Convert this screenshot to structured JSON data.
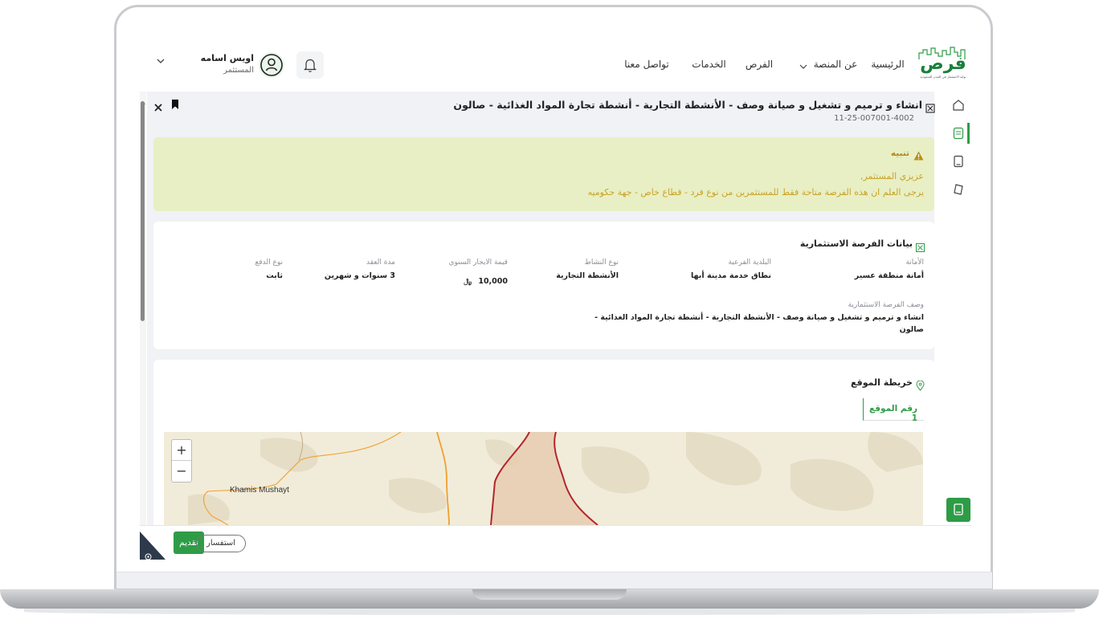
{
  "header": {
    "logo": {
      "name": "فرص",
      "tagline": "بوابة الاستثمار في المدن السعودية"
    },
    "nav": [
      "الرئيسية",
      "عن المنصة",
      "الفرص",
      "الخدمات",
      "تواصل معنا"
    ],
    "user": {
      "name": "اويس اسامه",
      "role": "المستثمر"
    }
  },
  "opportunity": {
    "title": "انشاء و ترميم و تشغيل و صيانة وصف - الأنشطة التجارية - أنشطة تجارة المواد الغذائية - صالون",
    "number": "11-25-007001-4002"
  },
  "alert": {
    "title": "تنبيه",
    "line1": "عزيزي المستثمر,",
    "line2": "يرجى العلم ان هذه الفرصة متاحة فقط للمستثمرين من نوع فرد - قطاع خاص - جهة حكوميه"
  },
  "details": {
    "section_title": "بيانات الفرصة الاستثمارية",
    "fields": [
      {
        "label": "الأمانة",
        "value": "أمانة منطقة عسير"
      },
      {
        "label": "البلدية الفرعية",
        "value": "نطاق خدمة مدينة أبها"
      },
      {
        "label": "نوع النشاط",
        "value": "الأنشطة التجارية"
      },
      {
        "label": "قيمة الايجار السنوي",
        "value": "10,000"
      },
      {
        "label": "مدة العقد",
        "value": "3 سنوات و شهرين"
      },
      {
        "label": "نوع الدفع",
        "value": "ثابت"
      }
    ],
    "description_label": "وصف الفرصة الاستثمارية",
    "description_line1": "انشاء و ترميم و تشغيل و صيانة وصف - الأنشطة التجارية - أنشطة تجارة المواد الغذائية -",
    "description_line2": "صالون"
  },
  "map": {
    "section_title": "خريطة الموقع",
    "site_tab": "رقم الموقع 1",
    "zoom_in": "+",
    "zoom_out": "−",
    "place_label": "Khamis Mushayt"
  },
  "footer": {
    "submit": "تقديم",
    "inquiry": "استفسار"
  },
  "colors": {
    "brand_green": "#2e9c47",
    "alert_bg": "#e8efc4",
    "alert_text": "#c9a227",
    "map_land": "#f1ecd9",
    "boundary_red": "#b3252c",
    "road_orange": "#f0a030"
  },
  "icons": [
    "home-icon",
    "document-icon",
    "notebook-icon",
    "tag-icon",
    "bell-icon",
    "user-icon",
    "chevron-down-icon",
    "bookmark-icon",
    "close-icon",
    "warning-icon",
    "location-icon",
    "settings-icon",
    "guide-icon"
  ]
}
